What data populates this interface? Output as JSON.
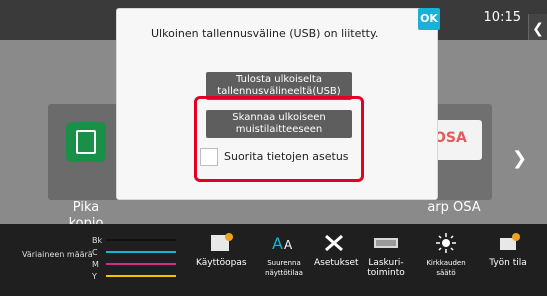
{
  "status": {
    "time": "10:15"
  },
  "tiles": [
    {
      "label": "Pika\nkopio",
      "icon": "copy-icon"
    },
    {
      "label": "arp OSA",
      "icon": "osa-icon",
      "logo_text": "OSA"
    }
  ],
  "modal": {
    "title": "Ulkoinen tallennusväline (USB) on liitetty.",
    "ok_label": "OK",
    "buttons": [
      {
        "label": "Tulosta ulkoiselta\ntallennusvälineeltä(USB)"
      },
      {
        "label": "Skannaa ulkoiseen\nmuistilaitteeseen"
      }
    ],
    "checkbox_label": "Suorita tietojen asetus"
  },
  "toner": {
    "title": "Väriaineen määrä",
    "rows": [
      {
        "label": "Bk",
        "color": "#111111"
      },
      {
        "label": "C",
        "color": "#19b2d6"
      },
      {
        "label": "M",
        "color": "#d12c8c"
      },
      {
        "label": "Y",
        "color": "#f2c400"
      }
    ]
  },
  "apps": [
    {
      "label": "Käyttöopas",
      "icon": "manual-icon"
    },
    {
      "label": "Suurenna\nnäyttötilaa",
      "icon": "text-size-icon"
    },
    {
      "label": "Asetukset",
      "icon": "settings-icon"
    },
    {
      "label": "Laskuri-\ntoiminto",
      "icon": "counter-icon"
    },
    {
      "label": "Kirkkauden\nsäätö",
      "icon": "brightness-icon"
    },
    {
      "label": "Työn tila",
      "icon": "job-status-icon"
    }
  ],
  "pagination": {
    "total": 4,
    "active": 1
  }
}
